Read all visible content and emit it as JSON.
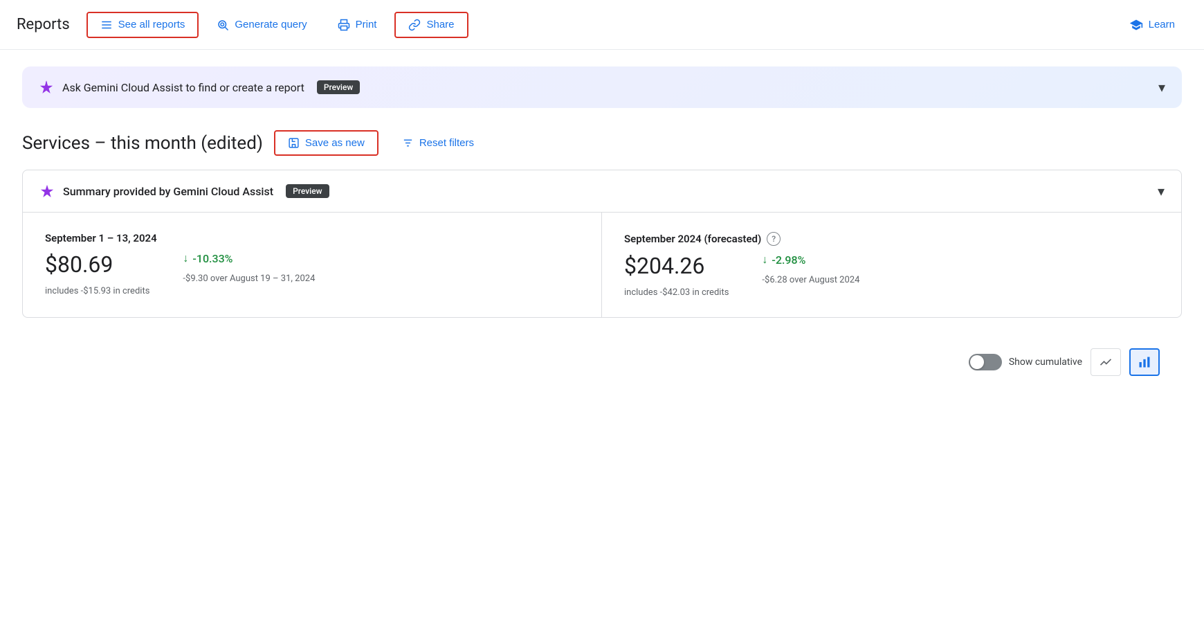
{
  "header": {
    "title": "Reports",
    "see_all_reports": "See all reports",
    "generate_query": "Generate query",
    "print": "Print",
    "share": "Share",
    "learn": "Learn"
  },
  "gemini_banner": {
    "text": "Ask Gemini Cloud Assist to find or create a report",
    "badge": "Preview"
  },
  "report": {
    "title": "Services – this month (edited)",
    "save_as_new": "Save as new",
    "reset_filters": "Reset filters"
  },
  "summary_card": {
    "header": "Summary provided by Gemini Cloud Assist",
    "badge": "Preview",
    "left_period": "September 1 – 13, 2024",
    "left_amount": "$80.69",
    "left_credits": "includes -$15.93 in credits",
    "left_change": "-10.33%",
    "left_change_detail": "-$9.30 over August 19 – 31, 2024",
    "right_period": "September 2024 (forecasted)",
    "right_amount": "$204.26",
    "right_credits": "includes -$42.03 in credits",
    "right_change": "-2.98%",
    "right_change_detail": "-$6.28 over August 2024"
  },
  "bottom_toolbar": {
    "show_cumulative": "Show cumulative"
  }
}
